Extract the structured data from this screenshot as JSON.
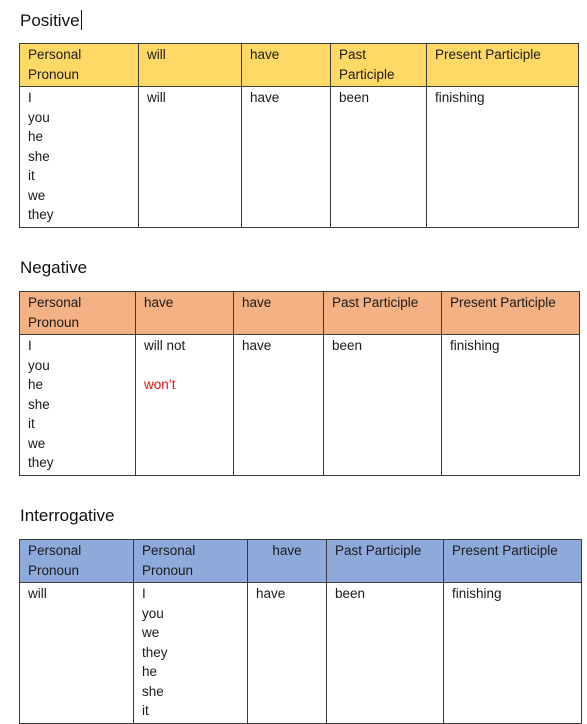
{
  "sections": {
    "positive": {
      "title": "Positive",
      "headers": [
        "Personal Pronoun",
        "will",
        "have",
        "Past Participle",
        "Present Participle"
      ],
      "pronouns": [
        "I",
        "you",
        "he",
        "she",
        "it",
        "we",
        "they"
      ],
      "aux1": "will",
      "aux2": "have",
      "past_participle": "been",
      "present_participle": "finishing"
    },
    "negative": {
      "title": "Negative",
      "headers": [
        "Personal Pronoun",
        "have",
        "have",
        "Past Participle",
        "Present Participle"
      ],
      "pronouns": [
        "I",
        "you",
        "he",
        "she",
        "it",
        "we",
        "they"
      ],
      "aux1": "will not",
      "aux1_contraction": "won’t",
      "aux2": "have",
      "past_participle": "been",
      "present_participle": "finishing"
    },
    "interrogative": {
      "title": "Interrogative",
      "headers": [
        "Personal Pronoun",
        "Personal Pronoun",
        "have",
        "Past Participle",
        "Present Participle"
      ],
      "aux1": "will",
      "pronouns": [
        "I",
        "you",
        "we",
        "they",
        "he",
        "she",
        "it"
      ],
      "aux2": "have",
      "past_participle": "been",
      "present_participle": "finishing"
    }
  },
  "colors": {
    "positive_header": "#ffd966",
    "negative_header": "#f4b183",
    "interrogative_header": "#8eaadb",
    "contraction_text": "#ee1111"
  }
}
